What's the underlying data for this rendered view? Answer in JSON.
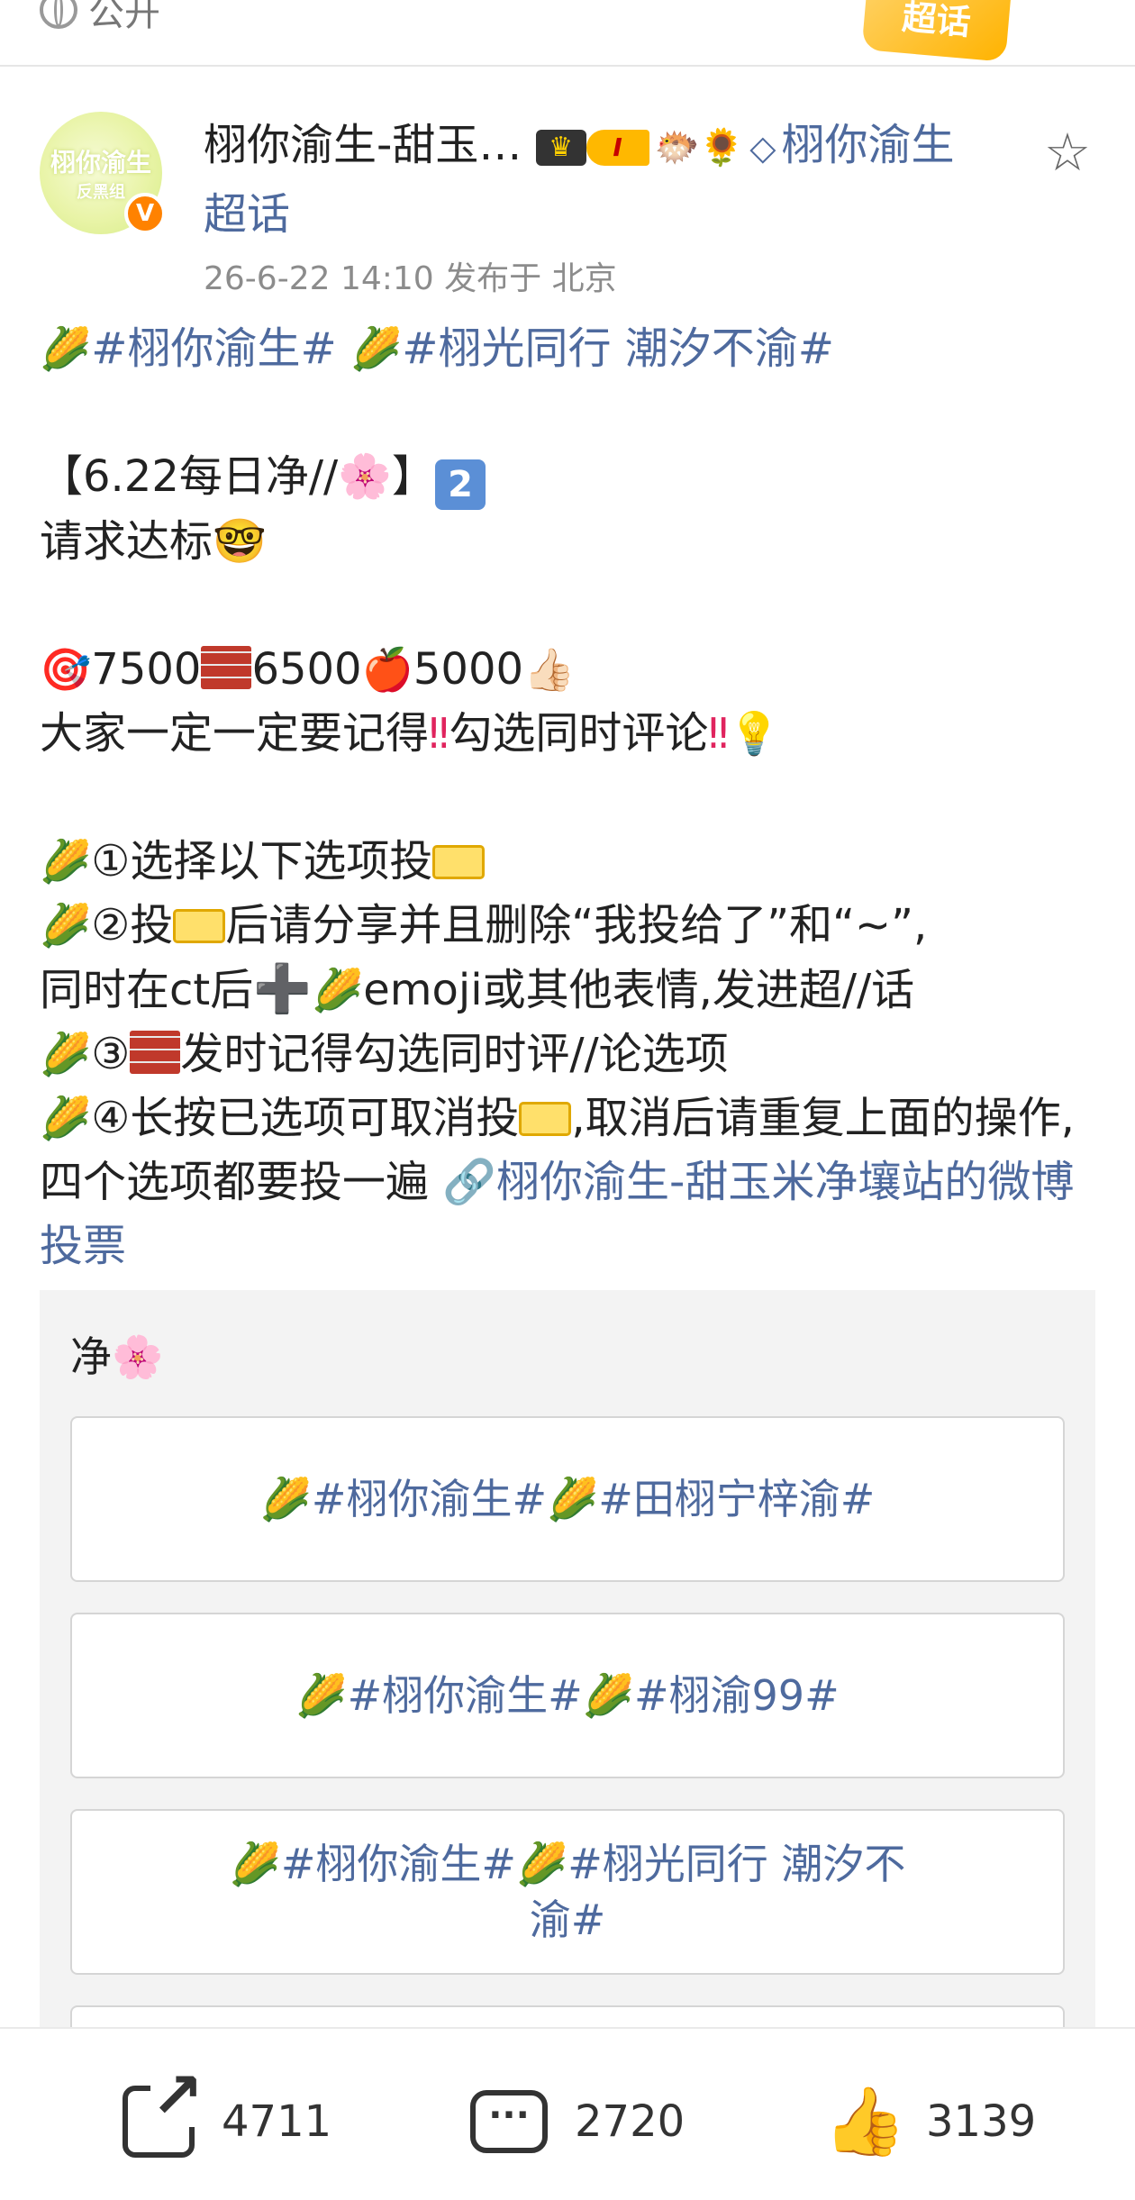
{
  "topbar": {
    "visibility_label": "公开",
    "tag_label": "超话"
  },
  "post": {
    "avatar_text": "栩你渝生",
    "avatar_sub": "反黑组",
    "verified_mark": "V",
    "username": "栩你渝生-甜玉…",
    "level_label": "I",
    "supertopic_label": "栩你渝生超话",
    "meta": "26-6-22 14:10  发布于 北京",
    "favorite_icon": "☆"
  },
  "content": {
    "line_hashtags": {
      "corn": "🌽",
      "tag1": "#栩你渝生#",
      "tag2": "#栩光同行 潮汐不渝#"
    },
    "line_daily": "【6.22每日净//🌸】",
    "line_daily_key": "2",
    "line_request": "请求达标🤓",
    "targets": {
      "target1": "7500",
      "target2": "6500",
      "target3": "5000"
    },
    "line_remember_a": "大家一定一定要记得",
    "line_remember_b": "勾选同时评论",
    "step1": "①选择以下选项投",
    "step2_a": "②投",
    "step2_b": "后请分享并且删除“我投给了”和“~”,",
    "step2_c": "同时在ct后",
    "step2_d": "emoji或其他表情,发进超//话",
    "step3_a": "③",
    "step3_b": "发时记得勾选同时评//论选项",
    "step4_a": "④长按已选项可取消投",
    "step4_b": ",取消后请重复上面的操作,四个选项都要投一遍 ",
    "vote_link": "🔗栩你渝生-甜玉米净壤站的微博投票"
  },
  "vote": {
    "title": "净🌸",
    "options": [
      "🌽#栩你渝生#🌽#田栩宁梓渝#",
      "🌽#栩你渝生#🌽#栩渝99#",
      "🌽#栩你渝生#🌽#栩光同行 潮汐不渝#"
    ]
  },
  "actions": {
    "share_count": "4711",
    "comment_count": "2720",
    "like_count": "3139"
  }
}
